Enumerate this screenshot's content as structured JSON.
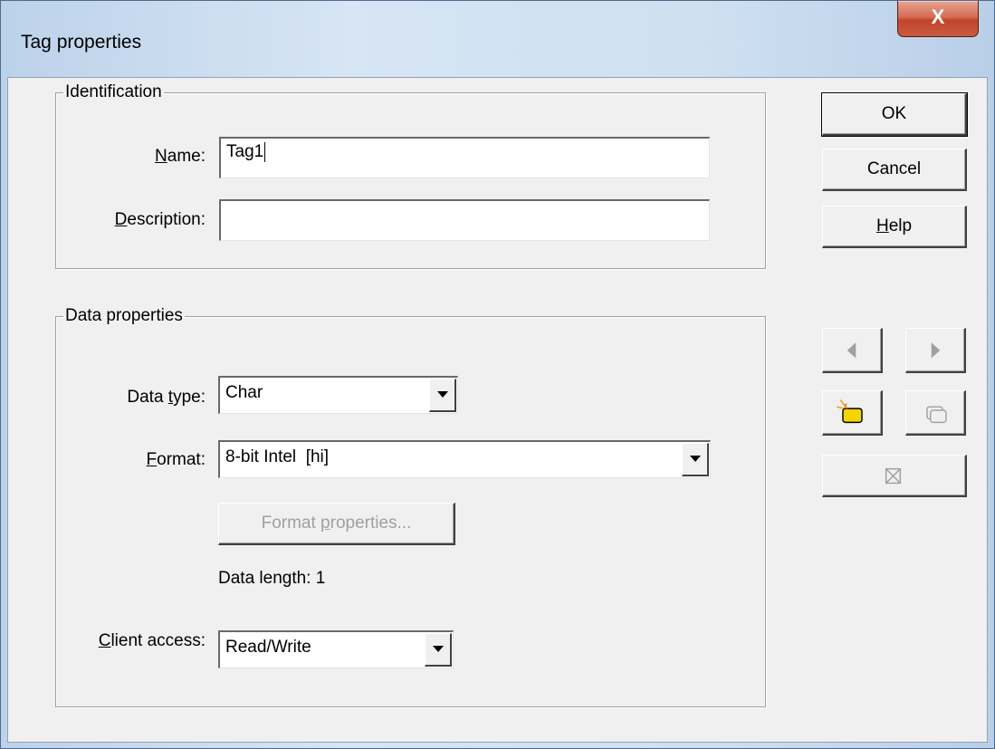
{
  "window": {
    "title": "Tag properties",
    "close_glyph": "X"
  },
  "identification": {
    "legend": "Identification",
    "name_label": "ame:",
    "name_mnemonic": "N",
    "name_value": "Tag1",
    "description_label": "escription:",
    "description_mnemonic": "D",
    "description_value": ""
  },
  "data_properties": {
    "legend": "Data properties",
    "data_type_label_prefix": "Data ",
    "data_type_mnemonic": "t",
    "data_type_label_suffix": "ype:",
    "data_type_value": "Char",
    "format_mnemonic": "F",
    "format_label": "ormat:",
    "format_value": "8-bit Intel  [hi]",
    "format_properties_prefix": "Format ",
    "format_properties_mnemonic": "p",
    "format_properties_suffix": "roperties...",
    "data_length_label": "Data length:",
    "data_length_value": "1",
    "client_access_mnemonic": "C",
    "client_access_label": "lient access:",
    "client_access_value": "Read/Write"
  },
  "buttons": {
    "ok": "OK",
    "cancel": "Cancel",
    "help_mnemonic": "H",
    "help_rest": "elp"
  },
  "icons": {
    "prev": "arrow-left-icon",
    "next": "arrow-right-icon",
    "new_tag": "new-tag-icon",
    "copy_tag": "copy-tag-icon",
    "delete_tag": "delete-tag-icon"
  }
}
